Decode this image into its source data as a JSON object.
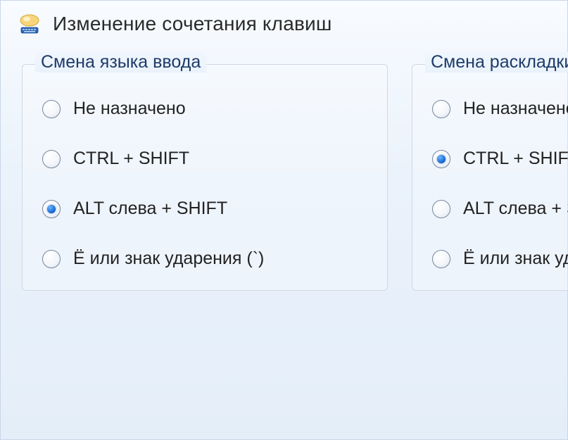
{
  "window": {
    "title": "Изменение сочетания клавиш"
  },
  "groups": [
    {
      "legend": "Смена языка ввода",
      "options": [
        {
          "label": "Не назначено",
          "selected": false
        },
        {
          "label": "CTRL + SHIFT",
          "selected": false
        },
        {
          "label": "ALT слева + SHIFT",
          "selected": true
        },
        {
          "label": "Ё или знак ударения (`)",
          "selected": false
        }
      ]
    },
    {
      "legend": "Смена раскладки клавиатуры",
      "options": [
        {
          "label": "Не назначено",
          "selected": false
        },
        {
          "label": "CTRL + SHIFT",
          "selected": true
        },
        {
          "label": "ALT слева + SHIFT",
          "selected": false
        },
        {
          "label": "Ё или знак ударения (`)",
          "selected": false
        }
      ]
    }
  ]
}
